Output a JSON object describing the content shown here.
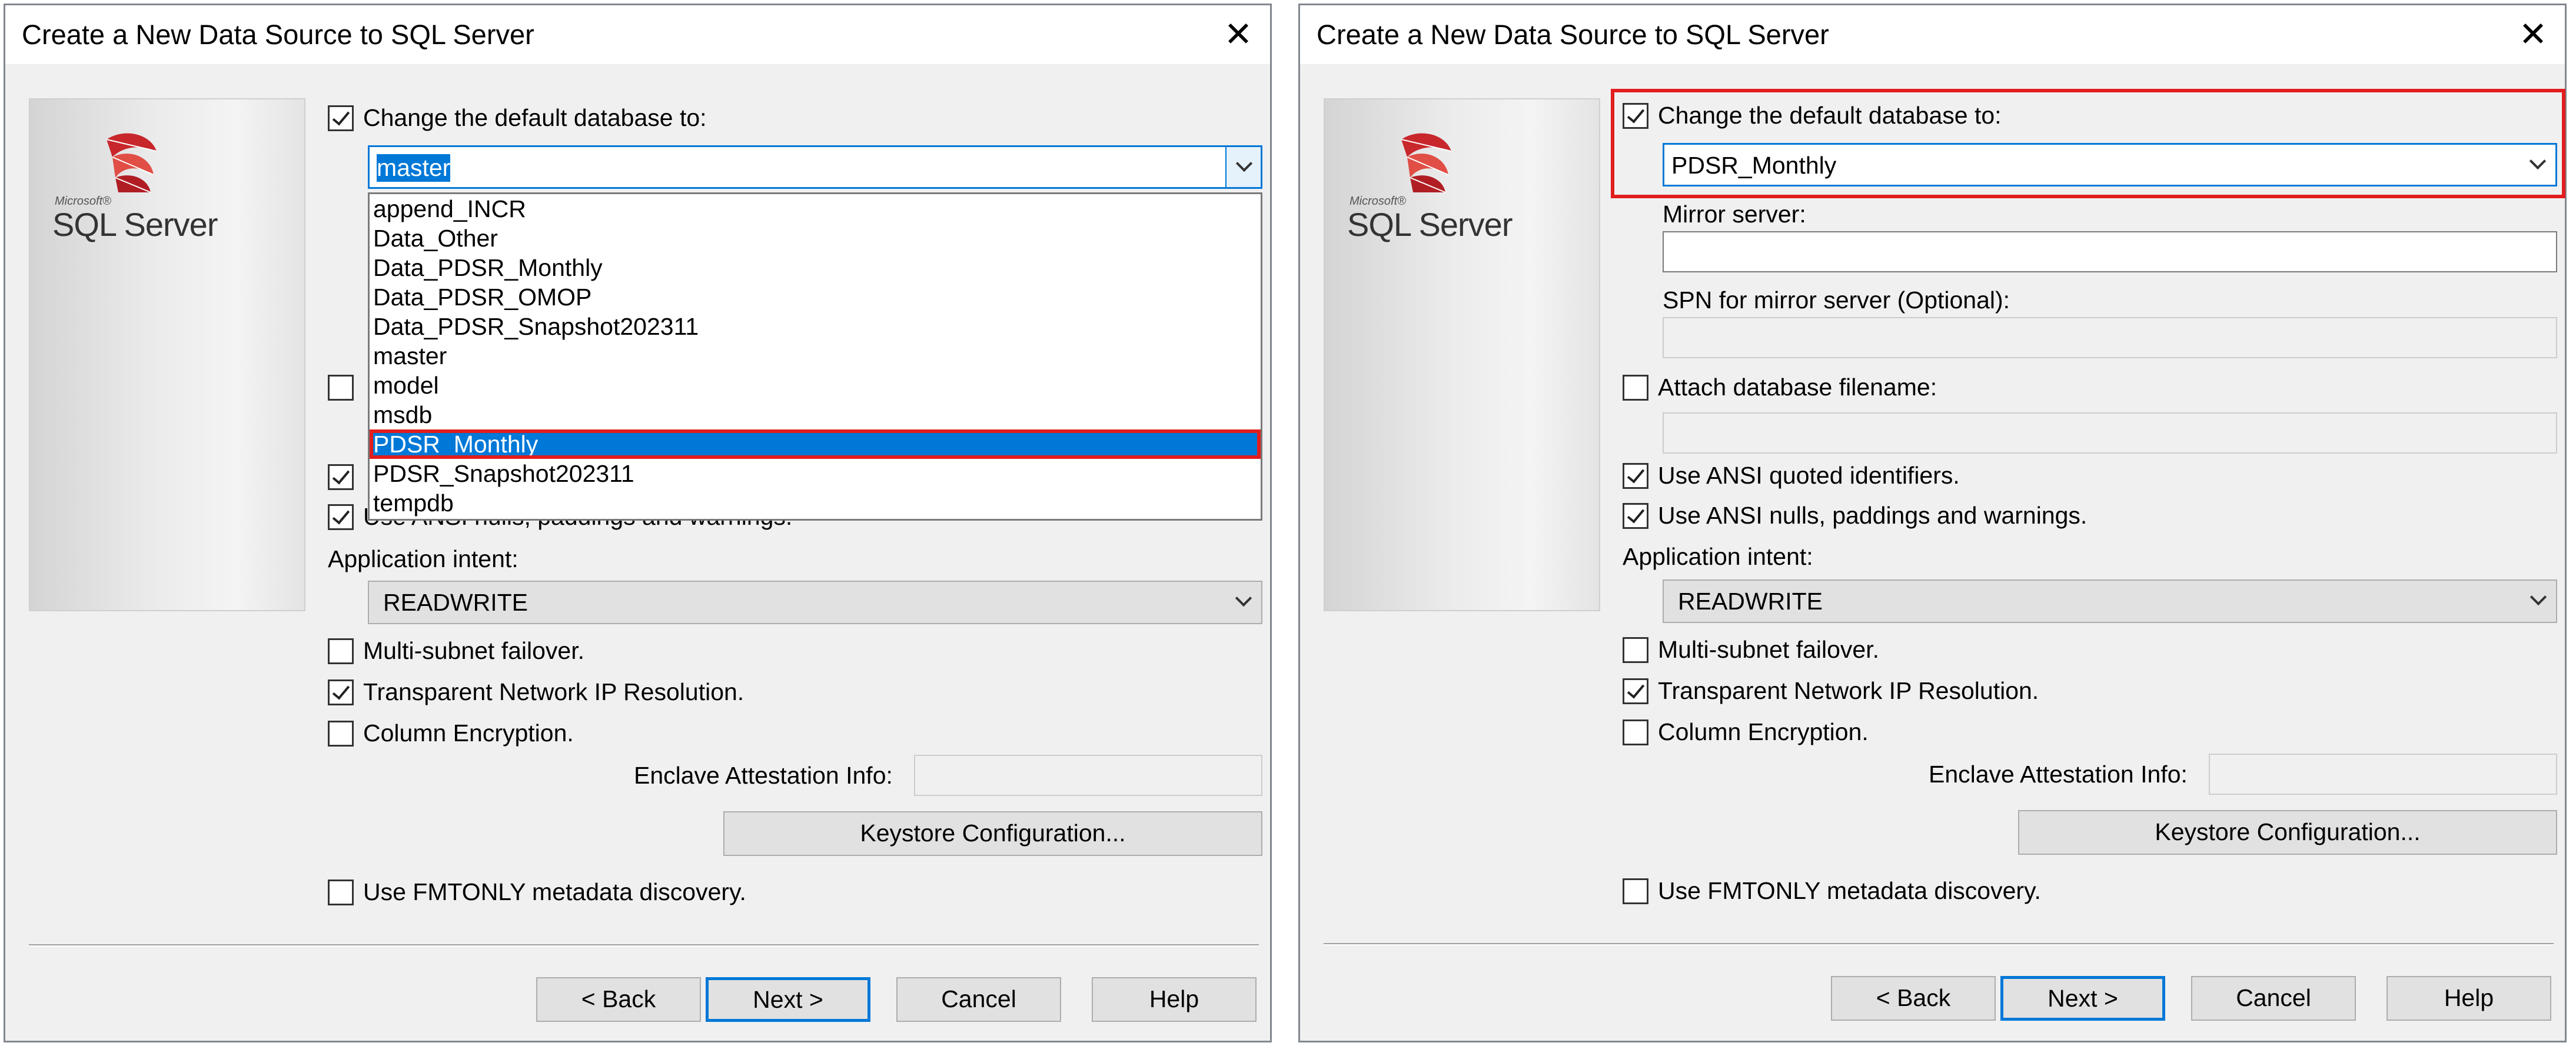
{
  "left_dialog": {
    "title": "Create a New Data Source to SQL Server",
    "close_glyph": "✕",
    "logo": {
      "ms": "Microsoft®",
      "text": "SQL Server"
    },
    "change_default_db": {
      "label": "Change the default database to:",
      "checked": true,
      "value": "master"
    },
    "dropdown_options": [
      "append_INCR",
      "Data_Other",
      "Data_PDSR_Monthly",
      "Data_PDSR_OMOP",
      "Data_PDSR_Snapshot202311",
      "master",
      "model",
      "msdb",
      "PDSR_Monthly",
      "PDSR_Snapshot202311",
      "tempdb"
    ],
    "highlighted_option": "PDSR_Monthly",
    "use_ansi_nulls_label": "Use ANSI nulls, paddings and warnings.",
    "app_intent": {
      "label": "Application intent:",
      "value": "READWRITE"
    },
    "multi_subnet_label": "Multi-subnet failover.",
    "tnir_label": "Transparent Network IP Resolution.",
    "column_encryption_label": "Column Encryption.",
    "enclave_label": "Enclave Attestation Info:",
    "keystore_button": "Keystore Configuration...",
    "fmtonly_label": "Use FMTONLY metadata discovery.",
    "buttons": {
      "back": "< Back",
      "next": "Next >",
      "cancel": "Cancel",
      "help": "Help"
    }
  },
  "right_dialog": {
    "title": "Create a New Data Source to SQL Server",
    "close_glyph": "✕",
    "logo": {
      "ms": "Microsoft®",
      "text": "SQL Server"
    },
    "change_default_db": {
      "label": "Change the default database to:",
      "checked": true,
      "value": "PDSR_Monthly"
    },
    "mirror_server_label": "Mirror server:",
    "mirror_server_value": "",
    "spn_label": "SPN for mirror server (Optional):",
    "attach_label": "Attach database filename:",
    "ansi_quoted_label": "Use ANSI quoted identifiers.",
    "ansi_nulls_label": "Use ANSI nulls, paddings and warnings.",
    "app_intent": {
      "label": "Application intent:",
      "value": "READWRITE"
    },
    "multi_subnet_label": "Multi-subnet failover.",
    "tnir_label": "Transparent Network IP Resolution.",
    "column_encryption_label": "Column Encryption.",
    "enclave_label": "Enclave Attestation Info:",
    "keystore_button": "Keystore Configuration...",
    "fmtonly_label": "Use FMTONLY metadata discovery.",
    "buttons": {
      "back": "< Back",
      "next": "Next >",
      "cancel": "Cancel",
      "help": "Help"
    }
  },
  "colors": {
    "highlight_annotation": "#e21d1d",
    "selection": "#0078d7",
    "dialog_bg": "#f0f0f0"
  }
}
